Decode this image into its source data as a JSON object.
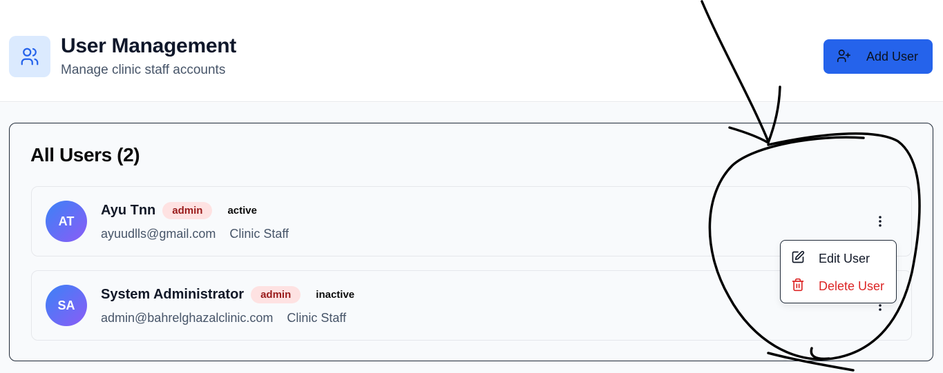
{
  "header": {
    "title": "User Management",
    "subtitle": "Manage clinic staff accounts",
    "icon": "users-icon",
    "add_button_label": "Add User",
    "add_button_icon": "user-plus-icon"
  },
  "users_card": {
    "title": "All Users (2)",
    "users": [
      {
        "initials": "AT",
        "name": "Ayu Tnn",
        "role": "admin",
        "status": "active",
        "email": "ayuudlls@gmail.com",
        "department": "Clinic Staff"
      },
      {
        "initials": "SA",
        "name": "System Administrator",
        "role": "admin",
        "status": "inactive",
        "email": "admin@bahrelghazalclinic.com",
        "department": "Clinic Staff"
      }
    ]
  },
  "row_menu": {
    "edit_label": "Edit User",
    "edit_icon": "edit-icon",
    "delete_label": "Delete User",
    "delete_icon": "trash-icon"
  },
  "colors": {
    "primary": "#2563eb",
    "header_icon_bg": "#dbeafe",
    "badge_bg": "#fee2e2",
    "badge_text": "#991b1b",
    "danger": "#dc2626"
  }
}
